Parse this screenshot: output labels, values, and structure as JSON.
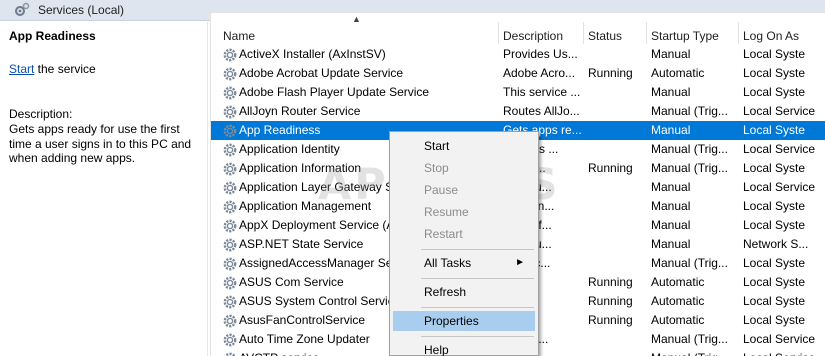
{
  "window": {
    "title": "Services (Local)"
  },
  "details": {
    "service_name": "App Readiness",
    "start_link": "Start",
    "start_suffix": " the service",
    "description_label": "Description:",
    "description": "Gets apps ready for use the first time a user signs in to this PC and when adding new apps."
  },
  "columns": [
    "Name",
    "Description",
    "Status",
    "Startup Type",
    "Log On As"
  ],
  "rows": [
    {
      "name": "ActiveX Installer (AxInstSV)",
      "description": "Provides Us...",
      "status": "",
      "startup": "Manual",
      "logon": "Local Syste"
    },
    {
      "name": "Adobe Acrobat Update Service",
      "description": "Adobe Acro...",
      "status": "Running",
      "startup": "Automatic",
      "logon": "Local Syste"
    },
    {
      "name": "Adobe Flash Player Update Service",
      "description": "This service ...",
      "status": "",
      "startup": "Manual",
      "logon": "Local Syste"
    },
    {
      "name": "AllJoyn Router Service",
      "description": "Routes AllJo...",
      "status": "",
      "startup": "Manual (Trig...",
      "logon": "Local Service"
    },
    {
      "name": "App Readiness",
      "description": "Gets apps re...",
      "status": "",
      "startup": "Manual",
      "logon": "Local Syste"
    },
    {
      "name": "Application Identity",
      "description": "...mines ...",
      "status": "",
      "startup": "Manual (Trig...",
      "logon": "Local Service"
    },
    {
      "name": "Application Information",
      "description": "...tes t...",
      "status": "Running",
      "startup": "Manual (Trig...",
      "logon": "Local Syste"
    },
    {
      "name": "Application Layer Gateway Se...",
      "description": "...es su...",
      "status": "",
      "startup": "Manual",
      "logon": "Local Service"
    },
    {
      "name": "Application Management",
      "description": "...ses in...",
      "status": "",
      "startup": "Manual",
      "logon": "Local Syste"
    },
    {
      "name": "AppX Deployment Service (A...",
      "description": "...es inf...",
      "status": "",
      "startup": "Manual",
      "logon": "Local Syste"
    },
    {
      "name": "ASP.NET State Service",
      "description": "...es su...",
      "status": "",
      "startup": "Manual",
      "logon": "Network S..."
    },
    {
      "name": "AssignedAccessManager Ser...",
      "description": "...edAc...",
      "status": "",
      "startup": "Manual (Trig...",
      "logon": "Local Syste"
    },
    {
      "name": "ASUS Com Service",
      "description": "",
      "status": "Running",
      "startup": "Automatic",
      "logon": "Local Syste"
    },
    {
      "name": "ASUS System Control Service",
      "description": "",
      "status": "Running",
      "startup": "Automatic",
      "logon": "Local Syste"
    },
    {
      "name": "AsusFanControlService",
      "description": "",
      "status": "Running",
      "startup": "Automatic",
      "logon": "Local Syste"
    },
    {
      "name": "Auto Time Zone Updater",
      "description": "...atica...",
      "status": "",
      "startup": "Manual (Trig...",
      "logon": "Local Service"
    },
    {
      "name": "AVCTP service",
      "description": "...",
      "status": "",
      "startup": "Manual (Trig...",
      "logon": "Local Service"
    }
  ],
  "selected_row": "App Readiness",
  "context_menu": {
    "start": "Start",
    "stop": "Stop",
    "pause": "Pause",
    "resume": "Resume",
    "restart": "Restart",
    "all_tasks": "All Tasks",
    "refresh": "Refresh",
    "properties": "Properties",
    "help": "Help"
  },
  "watermark": "APPUALS",
  "colors": {
    "selection": "#0078d7",
    "menu_highlight": "#a9cdee",
    "link": "#0a4fb0"
  }
}
